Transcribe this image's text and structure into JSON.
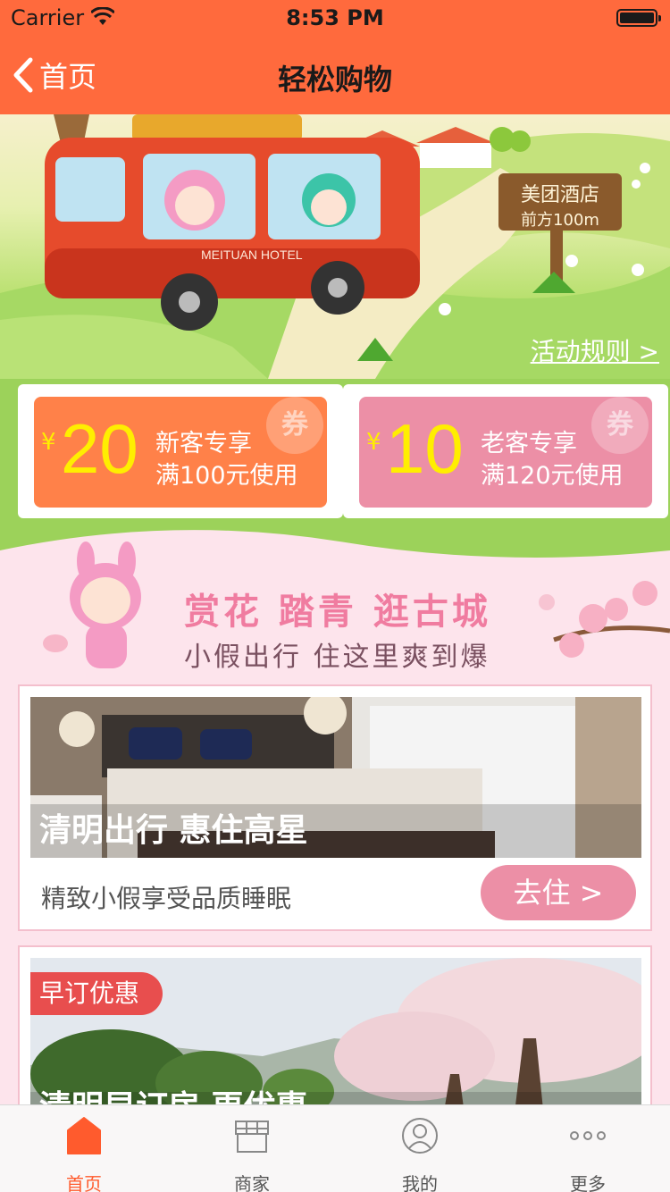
{
  "status": {
    "carrier": "Carrier",
    "time": "8:53 PM"
  },
  "nav": {
    "back_label": "首页",
    "title": "轻松购物"
  },
  "banner": {
    "bus_text": "MEITUAN HOTEL",
    "sign_line1": "美团酒店",
    "sign_line2": "前方100m",
    "rules_link": "活动规则 >"
  },
  "coupons": [
    {
      "currency": "¥",
      "amount": "20",
      "line1": "新客专享",
      "line2": "满100元使用",
      "stamp": "券"
    },
    {
      "currency": "¥",
      "amount": "10",
      "line1": "老客专享",
      "line2": "满120元使用",
      "stamp": "券"
    }
  ],
  "promo": {
    "headline": "赏花 踏青 逛古城",
    "subline": "小假出行 住这里爽到爆"
  },
  "cards": [
    {
      "photo_title": "清明出行 惠住高星",
      "description": "精致小假享受品质睡眠",
      "button": "去住 >"
    },
    {
      "tag": "早订优惠",
      "photo_title": "清明早订房 更优惠"
    }
  ],
  "tabs": [
    {
      "label": "首页",
      "active": true
    },
    {
      "label": "商家"
    },
    {
      "label": "我的"
    },
    {
      "label": "更多"
    }
  ],
  "colors": {
    "brand": "#ff6a3d",
    "coupon_orange": "#ff8149",
    "coupon_pink": "#ec8fa6",
    "coupon_amount": "#ffee00",
    "tab_active": "#ff5b2d"
  }
}
